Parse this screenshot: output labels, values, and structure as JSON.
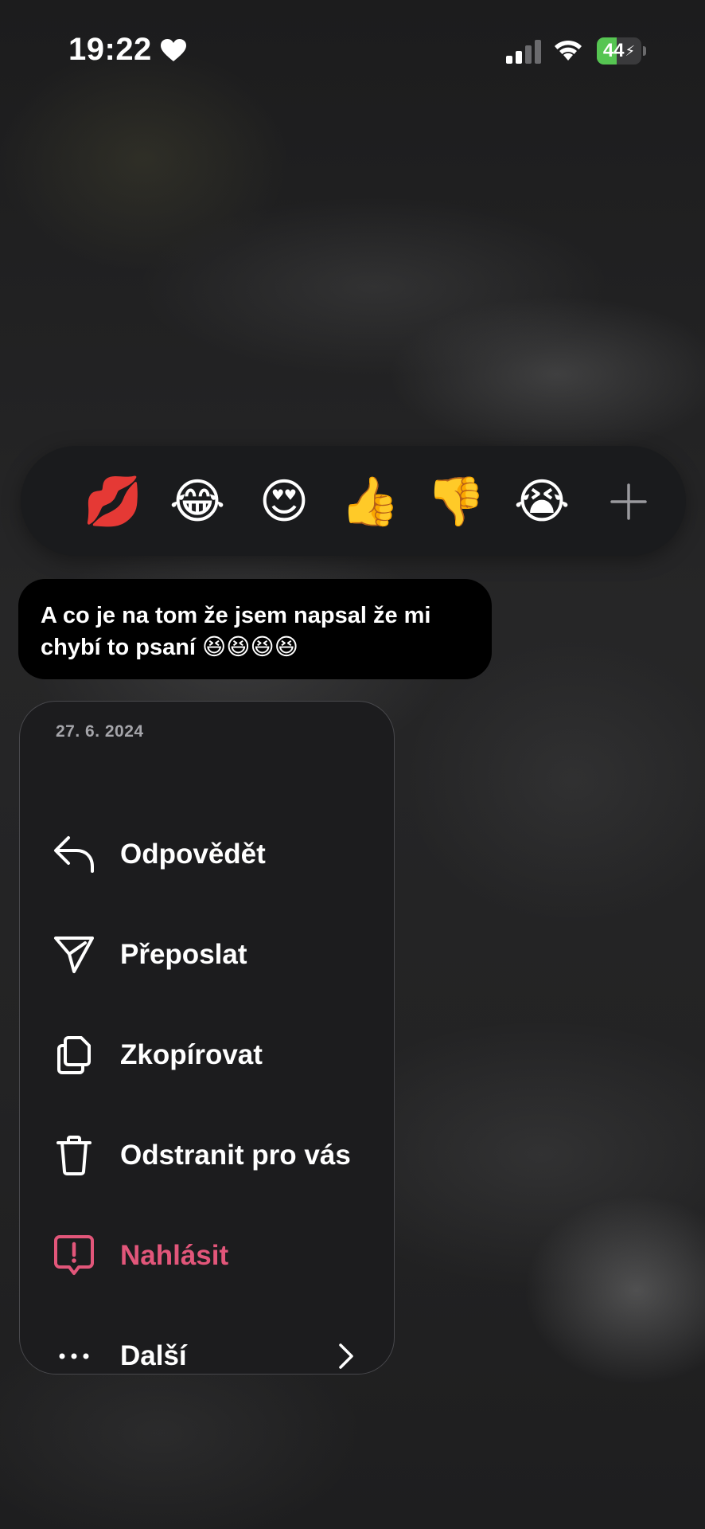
{
  "status_bar": {
    "time": "19:22",
    "battery_level": 44,
    "battery_text": "44",
    "battery_color": "#56c552"
  },
  "reactions": [
    {
      "emoji": "💋",
      "name": "kiss-mark"
    },
    {
      "emoji": "😂",
      "name": "face-with-tears-of-joy"
    },
    {
      "emoji": "😍",
      "name": "heart-eyes"
    },
    {
      "emoji": "👍",
      "name": "thumbs-up"
    },
    {
      "emoji": "👎",
      "name": "thumbs-down"
    },
    {
      "emoji": "😭",
      "name": "loudly-crying"
    },
    {
      "emoji": "+",
      "name": "add-reaction"
    }
  ],
  "message": {
    "line1": "A co je na tom že jsem napsal že mi",
    "line2": "chybí to psaní 😆😆😆😆"
  },
  "menu": {
    "date": "27. 6. 2024",
    "items": [
      {
        "label": "Odpovědět",
        "icon": "reply-icon"
      },
      {
        "label": "Přeposlat",
        "icon": "forward-icon"
      },
      {
        "label": "Zkopírovat",
        "icon": "copy-icon"
      },
      {
        "label": "Odstranit pro vás",
        "icon": "trash-icon"
      },
      {
        "label": "Nahlásit",
        "icon": "report-icon",
        "color": "#e2567a"
      },
      {
        "label": "Další",
        "icon": "more-icon"
      }
    ]
  }
}
